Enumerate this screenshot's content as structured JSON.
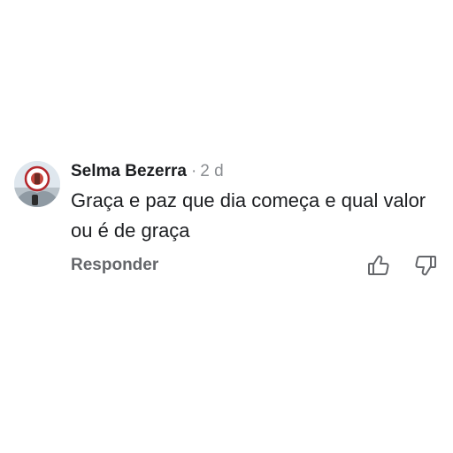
{
  "comment": {
    "author": "Selma Bezerra",
    "separator": "·",
    "time": "2 d",
    "text": "Graça e paz que dia começa e qual valor ou é de graça",
    "reply_label": "Responder",
    "icons": {
      "avatar": "profile-photo",
      "like": "thumbs-up-icon",
      "dislike": "thumbs-down-icon"
    },
    "colors": {
      "author": "#1c1e21",
      "muted": "#65676b",
      "timestamp": "#8a8d91"
    }
  }
}
